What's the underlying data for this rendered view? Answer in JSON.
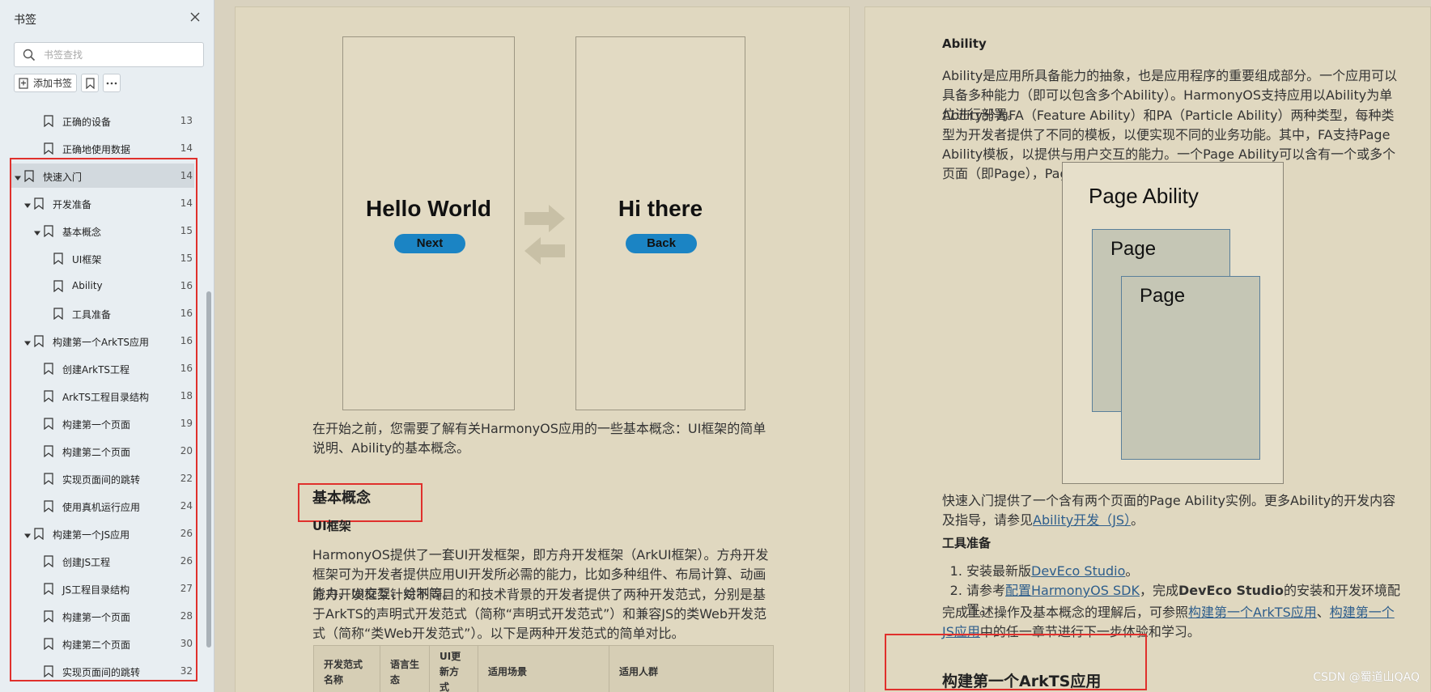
{
  "sidebar": {
    "title": "书签",
    "search_placeholder": "书签查找",
    "add_bookmark_label": "添加书签",
    "items": [
      {
        "label": "正确的设备",
        "page": "13",
        "level": 2,
        "caret": false,
        "selected": false
      },
      {
        "label": "正确地使用数据",
        "page": "14",
        "level": 2,
        "caret": false,
        "selected": false
      },
      {
        "label": "快速入门",
        "page": "14",
        "level": 0,
        "caret": true,
        "selected": true
      },
      {
        "label": "开发准备",
        "page": "14",
        "level": 1,
        "caret": true,
        "selected": false
      },
      {
        "label": "基本概念",
        "page": "15",
        "level": 2,
        "caret": true,
        "selected": false
      },
      {
        "label": "UI框架",
        "page": "15",
        "level": 3,
        "caret": false,
        "selected": false
      },
      {
        "label": "Ability",
        "page": "16",
        "level": 3,
        "caret": false,
        "selected": false
      },
      {
        "label": "工具准备",
        "page": "16",
        "level": 3,
        "caret": false,
        "selected": false
      },
      {
        "label": "构建第一个ArkTS应用",
        "page": "16",
        "level": 1,
        "caret": true,
        "selected": false
      },
      {
        "label": "创建ArkTS工程",
        "page": "16",
        "level": 2,
        "caret": false,
        "selected": false
      },
      {
        "label": "ArkTS工程目录结构",
        "page": "18",
        "level": 2,
        "caret": false,
        "selected": false
      },
      {
        "label": "构建第一个页面",
        "page": "19",
        "level": 2,
        "caret": false,
        "selected": false
      },
      {
        "label": "构建第二个页面",
        "page": "20",
        "level": 2,
        "caret": false,
        "selected": false
      },
      {
        "label": "实现页面间的跳转",
        "page": "22",
        "level": 2,
        "caret": false,
        "selected": false
      },
      {
        "label": "使用真机运行应用",
        "page": "24",
        "level": 2,
        "caret": false,
        "selected": false
      },
      {
        "label": "构建第一个JS应用",
        "page": "26",
        "level": 1,
        "caret": true,
        "selected": false
      },
      {
        "label": "创建JS工程",
        "page": "26",
        "level": 2,
        "caret": false,
        "selected": false
      },
      {
        "label": "JS工程目录结构",
        "page": "27",
        "level": 2,
        "caret": false,
        "selected": false
      },
      {
        "label": "构建第一个页面",
        "page": "28",
        "level": 2,
        "caret": false,
        "selected": false
      },
      {
        "label": "构建第二个页面",
        "page": "30",
        "level": 2,
        "caret": false,
        "selected": false
      },
      {
        "label": "实现页面间的跳转",
        "page": "32",
        "level": 2,
        "caret": false,
        "selected": false
      }
    ]
  },
  "left_page": {
    "phone1": {
      "title": "Hello World",
      "button": "Next"
    },
    "phone2": {
      "title": "Hi there",
      "button": "Back"
    },
    "intro": "在开始之前，您需要了解有关HarmonyOS应用的一些基本概念：UI框架的简单说明、Ability的基本概念。",
    "h_basic": "基本概念",
    "h_ui": "UI框架",
    "p1": "HarmonyOS提供了一套UI开发框架，即方舟开发框架（ArkUI框架）。方舟开发框架可为开发者提供应用UI开发所必需的能力，比如多种组件、布局计算、动画能力、UI交互、绘制等。",
    "p2": "方舟开发框架针对不同目的和技术背景的开发者提供了两种开发范式，分别是基于ArkTS的声明式开发范式（简称“声明式开发范式”）和兼容JS的类Web开发范式（简称“类Web开发范式”）。以下是两种开发范式的简单对比。",
    "table_headers": [
      "开发范式名称",
      "语言生态",
      "UI更新方式",
      "适用场景",
      "适用人群"
    ]
  },
  "right_page": {
    "h_ability": "Ability",
    "p1": "Ability是应用所具备能力的抽象，也是应用程序的重要组成部分。一个应用可以具备多种能力（即可以包含多个Ability）。HarmonyOS支持应用以Ability为单位进行部署。",
    "p2": "Ability分为FA（Feature Ability）和PA（Particle Ability）两种类型，每种类型为开发者提供了不同的模板，以便实现不同的业务功能。其中，FA支持Page Ability模板，以提供与用户交互的能力。一个Page Ability可以含有一个或多个页面（即Page），Page Ability与Page的关系如下图所示：",
    "diagram": {
      "outer": "Page Ability",
      "card1": "Page",
      "card2": "Page"
    },
    "p3_pre": "快速入门提供了一个含有两个页面的Page Ability实例。更多Ability的开发内容及指导，请参见",
    "p3_link": "Ability开发（JS）",
    "p3_post": "。",
    "h_tools": "工具准备",
    "li1_pre": "安装最新版",
    "li1_link": "DevEco Studio",
    "li1_post": "。",
    "li2_pre": "请参考",
    "li2_link": "配置HarmonyOS SDK",
    "li2_mid": "，完成",
    "li2_bold": "DevEco Studio",
    "li2_post": "的安装和开发环境配置。",
    "p4_pre": "完成上述操作及基本概念的理解后，可参照",
    "p4_link1": "构建第一个ArkTS应用",
    "p4_sep": "、",
    "p4_link2": "构建第一个JS应用",
    "p4_post": "中的任一章节进行下一步体验和学习。",
    "h_build": "构建第一个ArkTS应用"
  },
  "watermark": "CSDN @蜀道山QAQ"
}
